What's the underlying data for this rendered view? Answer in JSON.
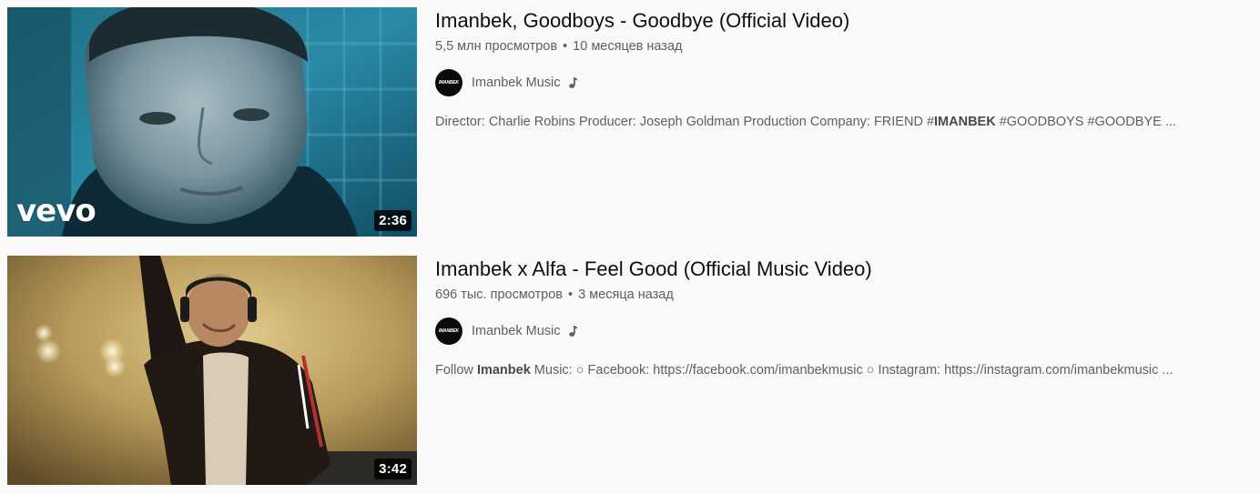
{
  "videos": [
    {
      "title": "Imanbek, Goodboys - Goodbye (Official Video)",
      "views": "5,5 млн просмотров",
      "age": "10 месяцев назад",
      "channel": "Imanbek Music",
      "channel_avatar_text": "IMANBEK",
      "badge_icon": "music-note-icon",
      "desc_prefix": "Director: Charlie Robins Producer: Joseph Goldman Production Company: FRIEND #",
      "desc_bold": "IMANBEK",
      "desc_suffix": " #GOODBOYS #GOODBYE ...",
      "duration": "2:36",
      "overlay_logo": "vevo"
    },
    {
      "title": "Imanbek x Alfa - Feel Good (Official Music Video)",
      "views": "696 тыс. просмотров",
      "age": "3 месяца назад",
      "channel": "Imanbek Music",
      "channel_avatar_text": "IMANBEK",
      "badge_icon": "music-note-icon",
      "desc_prefix": "Follow ",
      "desc_bold": "Imanbek",
      "desc_suffix": " Music: ○ Facebook: https://facebook.com/imanbekmusic ○ Instagram: https://instagram.com/imanbekmusic ...",
      "duration": "3:42"
    }
  ],
  "colors": {
    "background": "#f9f9f9",
    "title": "#0f0f0f",
    "secondary": "#606060"
  }
}
